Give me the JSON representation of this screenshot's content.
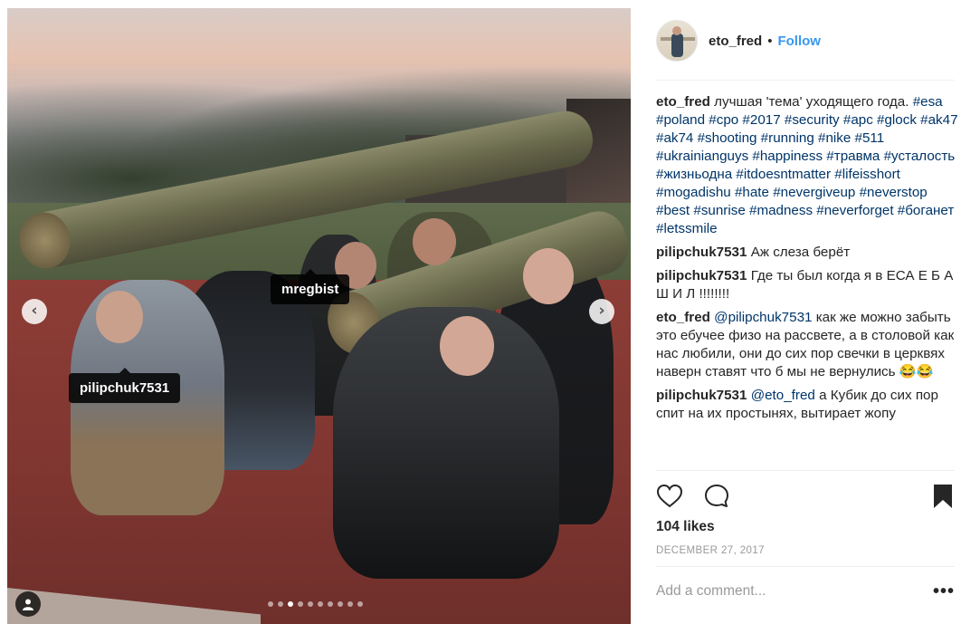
{
  "post": {
    "username": "eto_fred",
    "follow_label": "Follow",
    "separator": "•",
    "likes": "104 likes",
    "date": "DECEMBER 27, 2017",
    "add_comment_placeholder": "Add a comment...",
    "more_label": "•••"
  },
  "photo": {
    "tags": [
      "mregbist",
      "pilipchuk7531"
    ],
    "prev_glyph": "‹",
    "next_glyph": "›",
    "carousel_dots": 10,
    "active_dot": 3
  },
  "caption": {
    "user": "eto_fred",
    "text": "лучшая 'тема' уходящего года.",
    "hashtags": "#esa #poland #cpo #2017 #security #apc #glock #ak47 #ak74 #shooting #running #nike #511 #ukrainianguys #happiness #травма #усталость #жизньодна #itdoesntmatter #lifeisshort #mogadishu #hate #nevergiveup #neverstop #best #sunrise #madness #neverforget #боганет #letssmile"
  },
  "comments": [
    {
      "user": "pilipchuk7531",
      "mention": "",
      "text": "Аж слеза берёт"
    },
    {
      "user": "pilipchuk7531",
      "mention": "",
      "text": "Где ты был когда я в ЕСА Е Б А Ш И Л !!!!!!!!"
    },
    {
      "user": "eto_fred",
      "mention": "@pilipchuk7531",
      "text": "как же можно забыть это ебучее физо на рассвете, а в столовой как нас любили, они до сих пор свечки в церквях наверн ставят что б мы не вернулись 😂😂"
    },
    {
      "user": "pilipchuk7531",
      "mention": "@eto_fred",
      "text": "а Кубик до сих пор спит на их простынях, вытирает жопу"
    }
  ],
  "icons": {
    "like": "heart-icon",
    "comment": "speech-bubble-icon",
    "save": "bookmark-icon",
    "user_tag": "user-icon"
  },
  "colors": {
    "link": "#3897f0",
    "hashtag": "#003569",
    "muted": "#999999"
  }
}
